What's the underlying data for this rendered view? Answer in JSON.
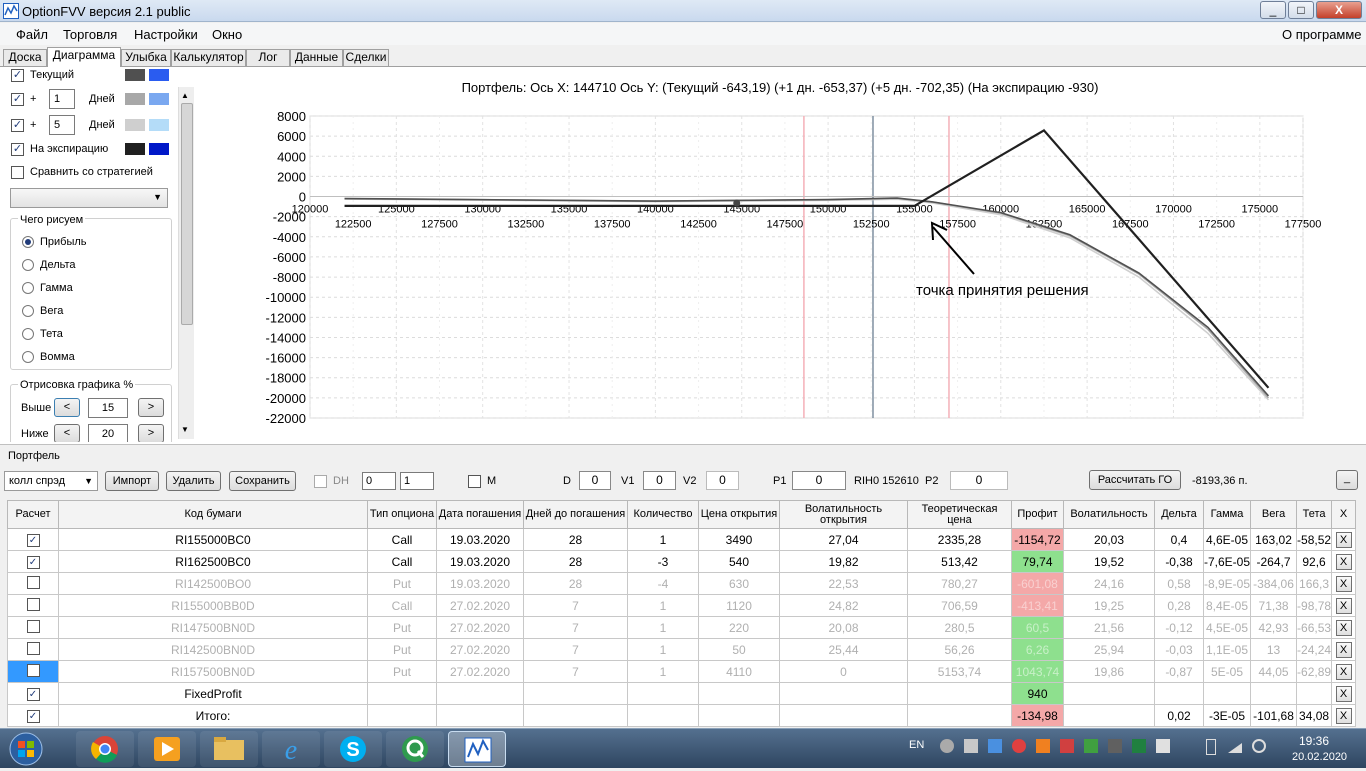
{
  "window": {
    "title": "OptionFVV версия 2.1 public",
    "minimize": "_",
    "maximize": "□",
    "close": "X"
  },
  "menu": {
    "items": [
      "Файл",
      "Торговля",
      "Настройки",
      "Окно"
    ],
    "about": "О программе"
  },
  "tabs": [
    "Доска",
    "Диаграмма",
    "Улыбка",
    "Калькулятор",
    "Лог",
    "Данные",
    "Сделки"
  ],
  "left_panel": {
    "current_label": "Текущий",
    "plus1": "+",
    "plus1_value": "1",
    "plus1_unit": "Дней",
    "plus5": "+",
    "plus5_value": "5",
    "plus5_unit": "Дней",
    "expiry_label": "На экспирацию",
    "compare_label": "Сравнить со стратегией",
    "draw_group_title": "Чего рисуем",
    "radios": [
      "Прибыль",
      "Дельта",
      "Гамма",
      "Вега",
      "Тета",
      "Вомма"
    ],
    "render_group_title": "Отрисовка графика %",
    "above_label": "Выше",
    "above_value": "15",
    "below_label": "Ниже",
    "below_value": "20",
    "prev": "<",
    "next": ">",
    "colors": {
      "current": [
        "#505050",
        "#2a5cf0"
      ],
      "plus1": [
        "#a8a8a8",
        "#7aa8f0"
      ],
      "plus5": [
        "#cfcfcf",
        "#b4dcf8"
      ],
      "expiry": [
        "#202020",
        "#0018c8"
      ]
    }
  },
  "chart_data": {
    "type": "line",
    "title": "Портфель:  Ось X:  144710  Ось Y:   (Текущий -643,19)   (+1 дн. -653,37)   (+5 дн. -702,35)   (На экспирацию -930)",
    "xlim": [
      120000,
      177500
    ],
    "ylim": [
      -22000,
      8000
    ],
    "y_ticks": [
      8000,
      6000,
      4000,
      2000,
      0,
      -2000,
      -4000,
      -6000,
      -8000,
      -10000,
      -12000,
      -14000,
      -16000,
      -18000,
      -20000,
      -22000
    ],
    "x_ticks_upper": [
      120000,
      125000,
      130000,
      135000,
      140000,
      145000,
      150000,
      155000,
      160000,
      165000,
      170000,
      175000
    ],
    "x_ticks_lower": [
      122500,
      127500,
      132500,
      137500,
      142500,
      147500,
      152500,
      157500,
      162500,
      167500,
      172500,
      177500
    ],
    "vlines": [
      {
        "x": 148600,
        "color": "#f4b0b8"
      },
      {
        "x": 152600,
        "color": "#7f8fa0"
      },
      {
        "x": 157000,
        "color": "#f4b0b8"
      }
    ],
    "series": [
      {
        "name": "На экспирацию",
        "color": "#202020",
        "points": [
          [
            122000,
            -930
          ],
          [
            155000,
            -930
          ],
          [
            162500,
            6570
          ],
          [
            175500,
            -19000
          ]
        ]
      },
      {
        "name": "Текущий",
        "color": "#505050",
        "points": [
          [
            122000,
            -200
          ],
          [
            140000,
            -450
          ],
          [
            150000,
            -300
          ],
          [
            154000,
            -150
          ],
          [
            156000,
            -520
          ],
          [
            160000,
            -1600
          ],
          [
            164000,
            -3800
          ],
          [
            168000,
            -7600
          ],
          [
            172000,
            -13000
          ],
          [
            175500,
            -19800
          ]
        ]
      },
      {
        "name": "+1 дн.",
        "color": "#a8a8a8",
        "points": [
          [
            122000,
            -210
          ],
          [
            140000,
            -460
          ],
          [
            150000,
            -320
          ],
          [
            154000,
            -180
          ],
          [
            156000,
            -540
          ],
          [
            160000,
            -1650
          ],
          [
            164000,
            -3900
          ],
          [
            168000,
            -7700
          ],
          [
            172000,
            -13200
          ],
          [
            175500,
            -20000
          ]
        ]
      },
      {
        "name": "+5 дн.",
        "color": "#cfcfcf",
        "points": [
          [
            122000,
            -250
          ],
          [
            140000,
            -500
          ],
          [
            150000,
            -380
          ],
          [
            154000,
            -260
          ],
          [
            156000,
            -620
          ],
          [
            160000,
            -1800
          ],
          [
            164000,
            -4100
          ],
          [
            168000,
            -8000
          ],
          [
            172000,
            -13600
          ],
          [
            175500,
            -20200
          ]
        ]
      }
    ],
    "marker": {
      "x": 144710,
      "y": -643
    },
    "annotation": "точка принятия решения"
  },
  "portfolio": {
    "group_title": "Портфель",
    "strategy": "колл спрэд",
    "import": "Импорт",
    "delete": "Удалить",
    "save": "Сохранить",
    "dh": "DH",
    "spin1": "0",
    "spin2": "1",
    "m": "M",
    "d_label": "D",
    "d_value": "0",
    "v1_label": "V1",
    "v1_value": "0",
    "v2_label": "V2",
    "v2_value": "0",
    "p1_label": "P1",
    "p1_value": "0",
    "ticker": "RIH0 152610",
    "p2_label": "P2",
    "p2_value": "0",
    "calc_go": "Рассчитать ГО",
    "go_value": "-8193,36 п.",
    "collapse": "_"
  },
  "table": {
    "headers": [
      "Расчет",
      "Код бумаги",
      "Тип опциона",
      "Дата погашения",
      "Дней до погашения",
      "Количество",
      "Цена открытия",
      "Волатильность открытия",
      "Теоретическая цена",
      "Профит",
      "Волатильность",
      "Дельта",
      "Гамма",
      "Вега",
      "Тета",
      "X"
    ],
    "rows": [
      {
        "checked": true,
        "dim": false,
        "cells": [
          "RI155000BC0",
          "Call",
          "19.03.2020",
          "28",
          "1",
          "3490",
          "27,04",
          "2335,28",
          "-1154,72",
          "20,03",
          "0,4",
          "4,6E-05",
          "163,02",
          "-58,52"
        ],
        "profit": "red"
      },
      {
        "checked": true,
        "dim": false,
        "cells": [
          "RI162500BC0",
          "Call",
          "19.03.2020",
          "28",
          "-3",
          "540",
          "19,82",
          "513,42",
          "79,74",
          "19,52",
          "-0,38",
          "-7,6E-05",
          "-264,7",
          "92,6"
        ],
        "profit": "green"
      },
      {
        "checked": false,
        "dim": true,
        "cells": [
          "RI142500BO0",
          "Put",
          "19.03.2020",
          "28",
          "-4",
          "630",
          "22,53",
          "780,27",
          "-601,08",
          "24,16",
          "0,58",
          "-8,9E-05",
          "-384,06",
          "166,3"
        ],
        "profit": "red2"
      },
      {
        "checked": false,
        "dim": true,
        "cells": [
          "RI155000BB0D",
          "Call",
          "27.02.2020",
          "7",
          "1",
          "1120",
          "24,82",
          "706,59",
          "-413,41",
          "19,25",
          "0,28",
          "8,4E-05",
          "71,38",
          "-98,78"
        ],
        "profit": "red2"
      },
      {
        "checked": false,
        "dim": true,
        "cells": [
          "RI147500BN0D",
          "Put",
          "27.02.2020",
          "7",
          "1",
          "220",
          "20,08",
          "280,5",
          "60,5",
          "21,56",
          "-0,12",
          "4,5E-05",
          "42,93",
          "-66,53"
        ],
        "profit": "green2"
      },
      {
        "checked": false,
        "dim": true,
        "cells": [
          "RI142500BN0D",
          "Put",
          "27.02.2020",
          "7",
          "1",
          "50",
          "25,44",
          "56,26",
          "6,26",
          "25,94",
          "-0,03",
          "1,1E-05",
          "13",
          "-24,24"
        ],
        "profit": "green2"
      },
      {
        "checked": false,
        "dim": true,
        "selected": true,
        "cells": [
          "RI157500BN0D",
          "Put",
          "27.02.2020",
          "7",
          "1",
          "4110",
          "0",
          "5153,74",
          "1043,74",
          "19,86",
          "-0,87",
          "5E-05",
          "44,05",
          "-62,89"
        ],
        "profit": "green2"
      },
      {
        "checked": true,
        "dim": false,
        "cells": [
          "FixedProfit",
          "",
          "",
          "",
          "",
          "",
          "",
          "",
          "940",
          "",
          "",
          "",
          "",
          ""
        ],
        "profit": "green"
      },
      {
        "checked": true,
        "dim": false,
        "cells": [
          "Итого:",
          "",
          "",
          "",
          "",
          "",
          "",
          "",
          "-134,98",
          "",
          "0,02",
          "-3E-05",
          "-101,68",
          "34,08"
        ],
        "profit": "red"
      }
    ],
    "remove": "X"
  },
  "taskbar": {
    "lang": "EN",
    "time": "19:36",
    "date": "20.02.2020"
  }
}
